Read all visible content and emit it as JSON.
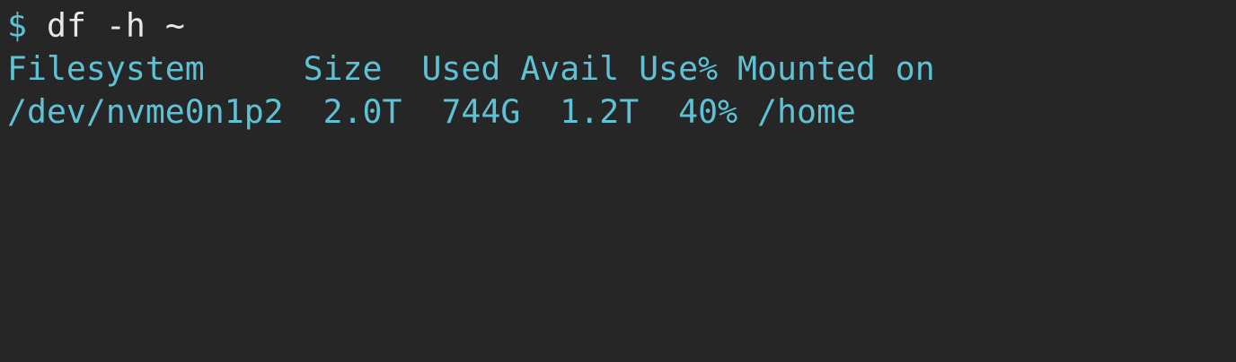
{
  "terminal": {
    "prompt_symbol": "$",
    "command": "df -h ~",
    "colors": {
      "background": "#262626",
      "prompt": "#5ec2d4",
      "command_text": "#e8e8e8",
      "output_text": "#5ec2d4"
    },
    "table": {
      "headers": [
        "Filesystem",
        "Size",
        "Used",
        "Avail",
        "Use%",
        "Mounted on"
      ],
      "rows": [
        [
          "/dev/nvme0n1p2",
          "2.0T",
          "744G",
          "1.2T",
          "40%",
          "/home"
        ]
      ]
    }
  }
}
